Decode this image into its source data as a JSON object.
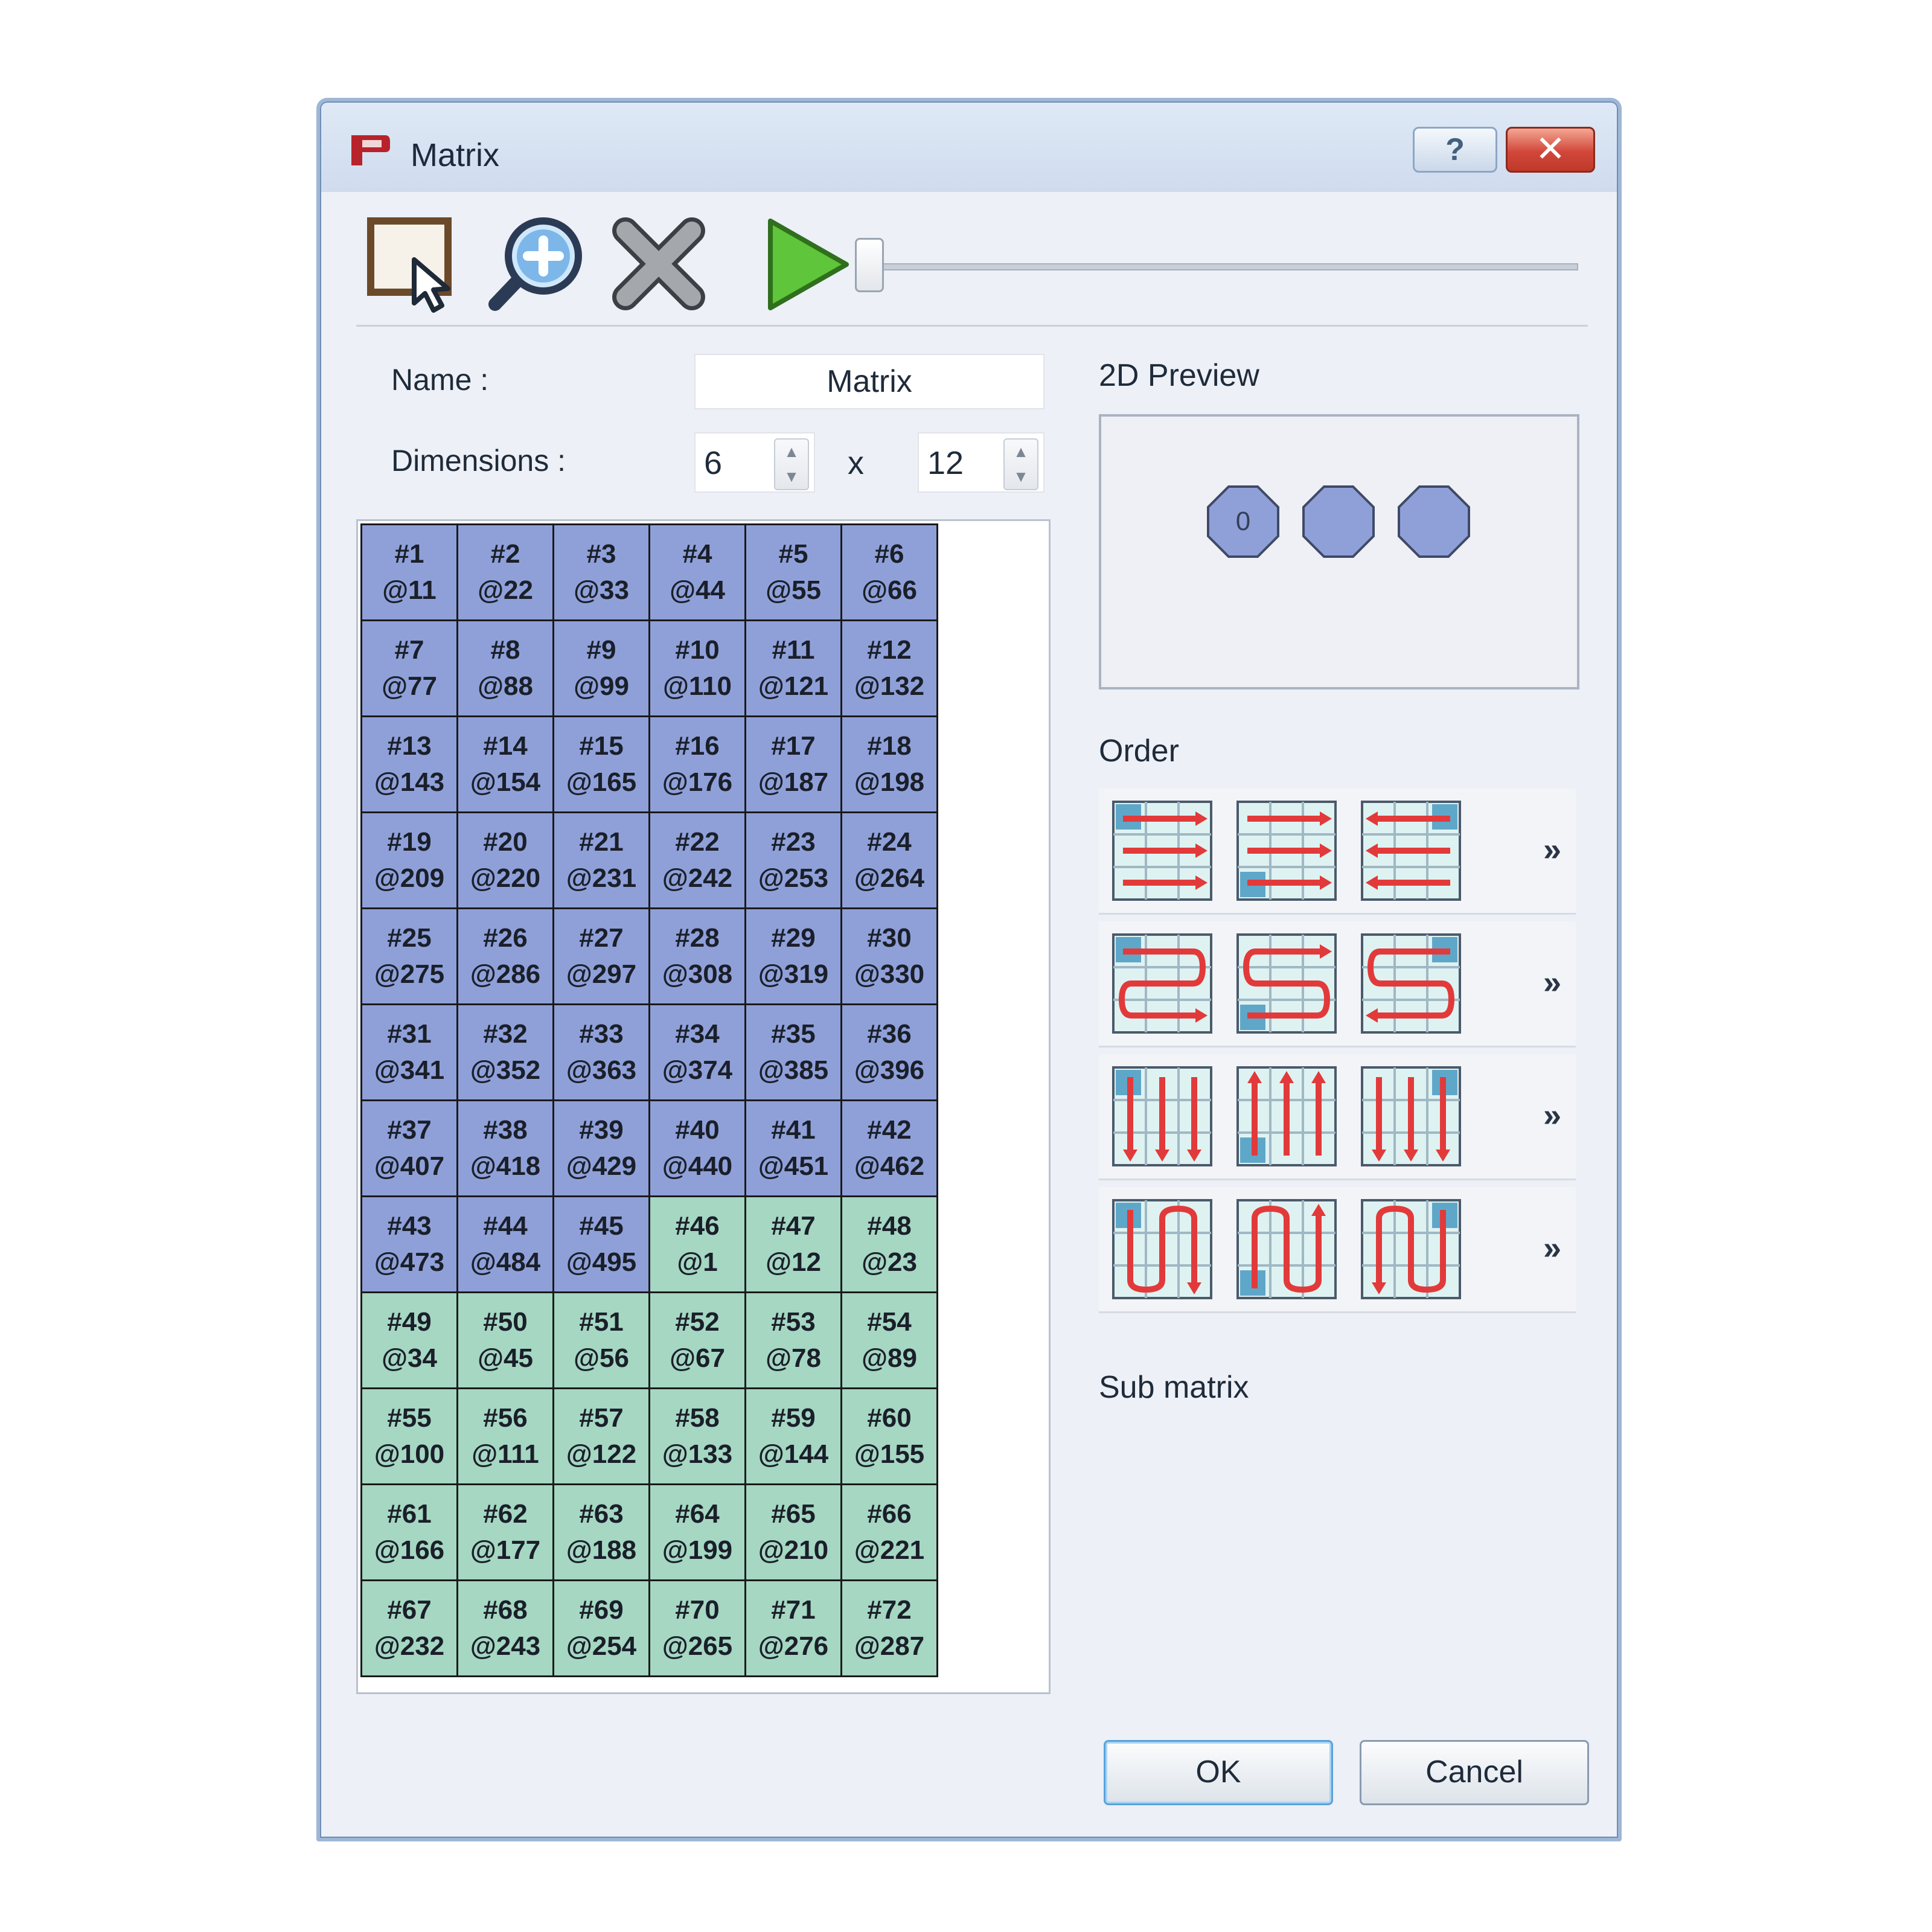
{
  "window": {
    "title": "Matrix",
    "help_label": "?",
    "close_label": "✕"
  },
  "toolbar": {
    "select_icon": "select-area-icon",
    "zoom_icon": "zoom-in-icon",
    "delete_icon": "delete-icon",
    "play_icon": "play-icon",
    "slider_value": 0
  },
  "form": {
    "name_label": "Name :",
    "name_value": "Matrix",
    "dimensions_label": "Dimensions :",
    "dim_x": "6",
    "times": "x",
    "dim_y": "12"
  },
  "matrix": {
    "cells": [
      {
        "id": "#1",
        "addr": "@11",
        "c": "blue"
      },
      {
        "id": "#2",
        "addr": "@22",
        "c": "blue"
      },
      {
        "id": "#3",
        "addr": "@33",
        "c": "blue"
      },
      {
        "id": "#4",
        "addr": "@44",
        "c": "blue"
      },
      {
        "id": "#5",
        "addr": "@55",
        "c": "blue"
      },
      {
        "id": "#6",
        "addr": "@66",
        "c": "blue"
      },
      {
        "id": "#7",
        "addr": "@77",
        "c": "blue"
      },
      {
        "id": "#8",
        "addr": "@88",
        "c": "blue"
      },
      {
        "id": "#9",
        "addr": "@99",
        "c": "blue"
      },
      {
        "id": "#10",
        "addr": "@110",
        "c": "blue"
      },
      {
        "id": "#11",
        "addr": "@121",
        "c": "blue"
      },
      {
        "id": "#12",
        "addr": "@132",
        "c": "blue"
      },
      {
        "id": "#13",
        "addr": "@143",
        "c": "blue"
      },
      {
        "id": "#14",
        "addr": "@154",
        "c": "blue"
      },
      {
        "id": "#15",
        "addr": "@165",
        "c": "blue"
      },
      {
        "id": "#16",
        "addr": "@176",
        "c": "blue"
      },
      {
        "id": "#17",
        "addr": "@187",
        "c": "blue"
      },
      {
        "id": "#18",
        "addr": "@198",
        "c": "blue"
      },
      {
        "id": "#19",
        "addr": "@209",
        "c": "blue"
      },
      {
        "id": "#20",
        "addr": "@220",
        "c": "blue"
      },
      {
        "id": "#21",
        "addr": "@231",
        "c": "blue"
      },
      {
        "id": "#22",
        "addr": "@242",
        "c": "blue"
      },
      {
        "id": "#23",
        "addr": "@253",
        "c": "blue"
      },
      {
        "id": "#24",
        "addr": "@264",
        "c": "blue"
      },
      {
        "id": "#25",
        "addr": "@275",
        "c": "blue"
      },
      {
        "id": "#26",
        "addr": "@286",
        "c": "blue"
      },
      {
        "id": "#27",
        "addr": "@297",
        "c": "blue"
      },
      {
        "id": "#28",
        "addr": "@308",
        "c": "blue"
      },
      {
        "id": "#29",
        "addr": "@319",
        "c": "blue"
      },
      {
        "id": "#30",
        "addr": "@330",
        "c": "blue"
      },
      {
        "id": "#31",
        "addr": "@341",
        "c": "blue"
      },
      {
        "id": "#32",
        "addr": "@352",
        "c": "blue"
      },
      {
        "id": "#33",
        "addr": "@363",
        "c": "blue"
      },
      {
        "id": "#34",
        "addr": "@374",
        "c": "blue"
      },
      {
        "id": "#35",
        "addr": "@385",
        "c": "blue"
      },
      {
        "id": "#36",
        "addr": "@396",
        "c": "blue"
      },
      {
        "id": "#37",
        "addr": "@407",
        "c": "blue"
      },
      {
        "id": "#38",
        "addr": "@418",
        "c": "blue"
      },
      {
        "id": "#39",
        "addr": "@429",
        "c": "blue"
      },
      {
        "id": "#40",
        "addr": "@440",
        "c": "blue"
      },
      {
        "id": "#41",
        "addr": "@451",
        "c": "blue"
      },
      {
        "id": "#42",
        "addr": "@462",
        "c": "blue"
      },
      {
        "id": "#43",
        "addr": "@473",
        "c": "blue"
      },
      {
        "id": "#44",
        "addr": "@484",
        "c": "blue"
      },
      {
        "id": "#45",
        "addr": "@495",
        "c": "blue"
      },
      {
        "id": "#46",
        "addr": "@1",
        "c": "green"
      },
      {
        "id": "#47",
        "addr": "@12",
        "c": "green"
      },
      {
        "id": "#48",
        "addr": "@23",
        "c": "green"
      },
      {
        "id": "#49",
        "addr": "@34",
        "c": "green"
      },
      {
        "id": "#50",
        "addr": "@45",
        "c": "green"
      },
      {
        "id": "#51",
        "addr": "@56",
        "c": "green"
      },
      {
        "id": "#52",
        "addr": "@67",
        "c": "green"
      },
      {
        "id": "#53",
        "addr": "@78",
        "c": "green"
      },
      {
        "id": "#54",
        "addr": "@89",
        "c": "green"
      },
      {
        "id": "#55",
        "addr": "@100",
        "c": "green"
      },
      {
        "id": "#56",
        "addr": "@111",
        "c": "green"
      },
      {
        "id": "#57",
        "addr": "@122",
        "c": "green"
      },
      {
        "id": "#58",
        "addr": "@133",
        "c": "green"
      },
      {
        "id": "#59",
        "addr": "@144",
        "c": "green"
      },
      {
        "id": "#60",
        "addr": "@155",
        "c": "green"
      },
      {
        "id": "#61",
        "addr": "@166",
        "c": "green"
      },
      {
        "id": "#62",
        "addr": "@177",
        "c": "green"
      },
      {
        "id": "#63",
        "addr": "@188",
        "c": "green"
      },
      {
        "id": "#64",
        "addr": "@199",
        "c": "green"
      },
      {
        "id": "#65",
        "addr": "@210",
        "c": "green"
      },
      {
        "id": "#66",
        "addr": "@221",
        "c": "green"
      },
      {
        "id": "#67",
        "addr": "@232",
        "c": "green"
      },
      {
        "id": "#68",
        "addr": "@243",
        "c": "green"
      },
      {
        "id": "#69",
        "addr": "@254",
        "c": "green"
      },
      {
        "id": "#70",
        "addr": "@265",
        "c": "green"
      },
      {
        "id": "#71",
        "addr": "@276",
        "c": "green"
      },
      {
        "id": "#72",
        "addr": "@287",
        "c": "green"
      }
    ]
  },
  "preview": {
    "title": "2D Preview",
    "first_label": "0"
  },
  "order": {
    "title": "Order",
    "more_label": "»",
    "rows": [
      {
        "icons": [
          "order-rows-icon",
          "order-rows-bottom-icon",
          "order-rows-right-icon"
        ]
      },
      {
        "icons": [
          "order-snake-icon",
          "order-snake-bottom-icon",
          "order-snake-right-icon"
        ]
      },
      {
        "icons": [
          "order-columns-icon",
          "order-columns-bottom-icon",
          "order-columns-right-icon"
        ]
      },
      {
        "icons": [
          "order-column-snake-icon",
          "order-column-snake-bottom-icon",
          "order-column-snake-right-icon"
        ]
      }
    ]
  },
  "submatrix": {
    "title": "Sub matrix"
  },
  "buttons": {
    "ok": "OK",
    "cancel": "Cancel"
  },
  "colors": {
    "cell_blue": "#8fa0d9",
    "cell_green": "#a5d7c3",
    "preview_fill": "#8fa0d9",
    "arrow_red": "#e23a3a",
    "close_red": "#c0392b"
  }
}
